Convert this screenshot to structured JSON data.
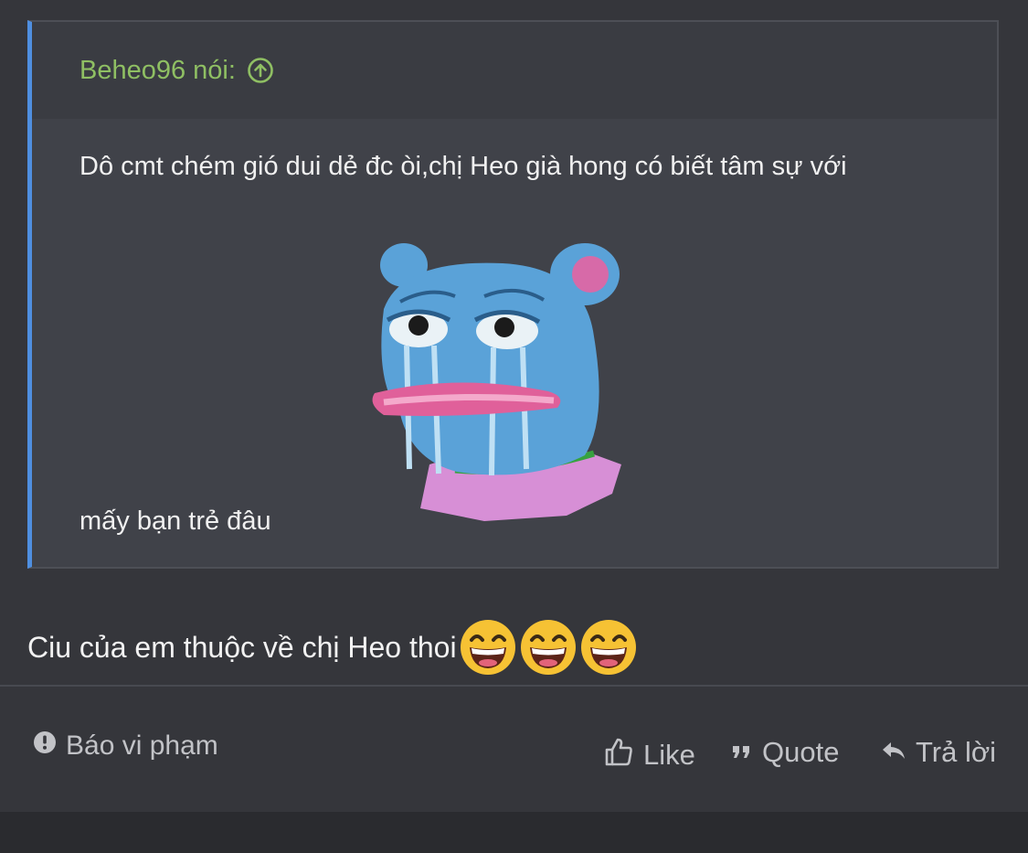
{
  "quote": {
    "author_label": "Beheo96 nói:",
    "text_line1": "Dô cmt chém gió dui dẻ đc òi,chị Heo già hong có biết tâm sự với",
    "text_line2": "mấy bạn trẻ đâu",
    "sticker": "crying-blue-pig-sticker"
  },
  "reply": {
    "text": "Ciu của em thuộc về chị Heo thoi",
    "emojis": [
      "grinning-face",
      "grinning-face",
      "grinning-face"
    ]
  },
  "actions": {
    "report_label": "Báo vi phạm",
    "like_label": "Like",
    "quote_label": "Quote",
    "reply_label": "Trả lời"
  },
  "colors": {
    "quote_accent": "#4f8fe0",
    "author_color": "#8fbf63",
    "background": "#35363b"
  }
}
